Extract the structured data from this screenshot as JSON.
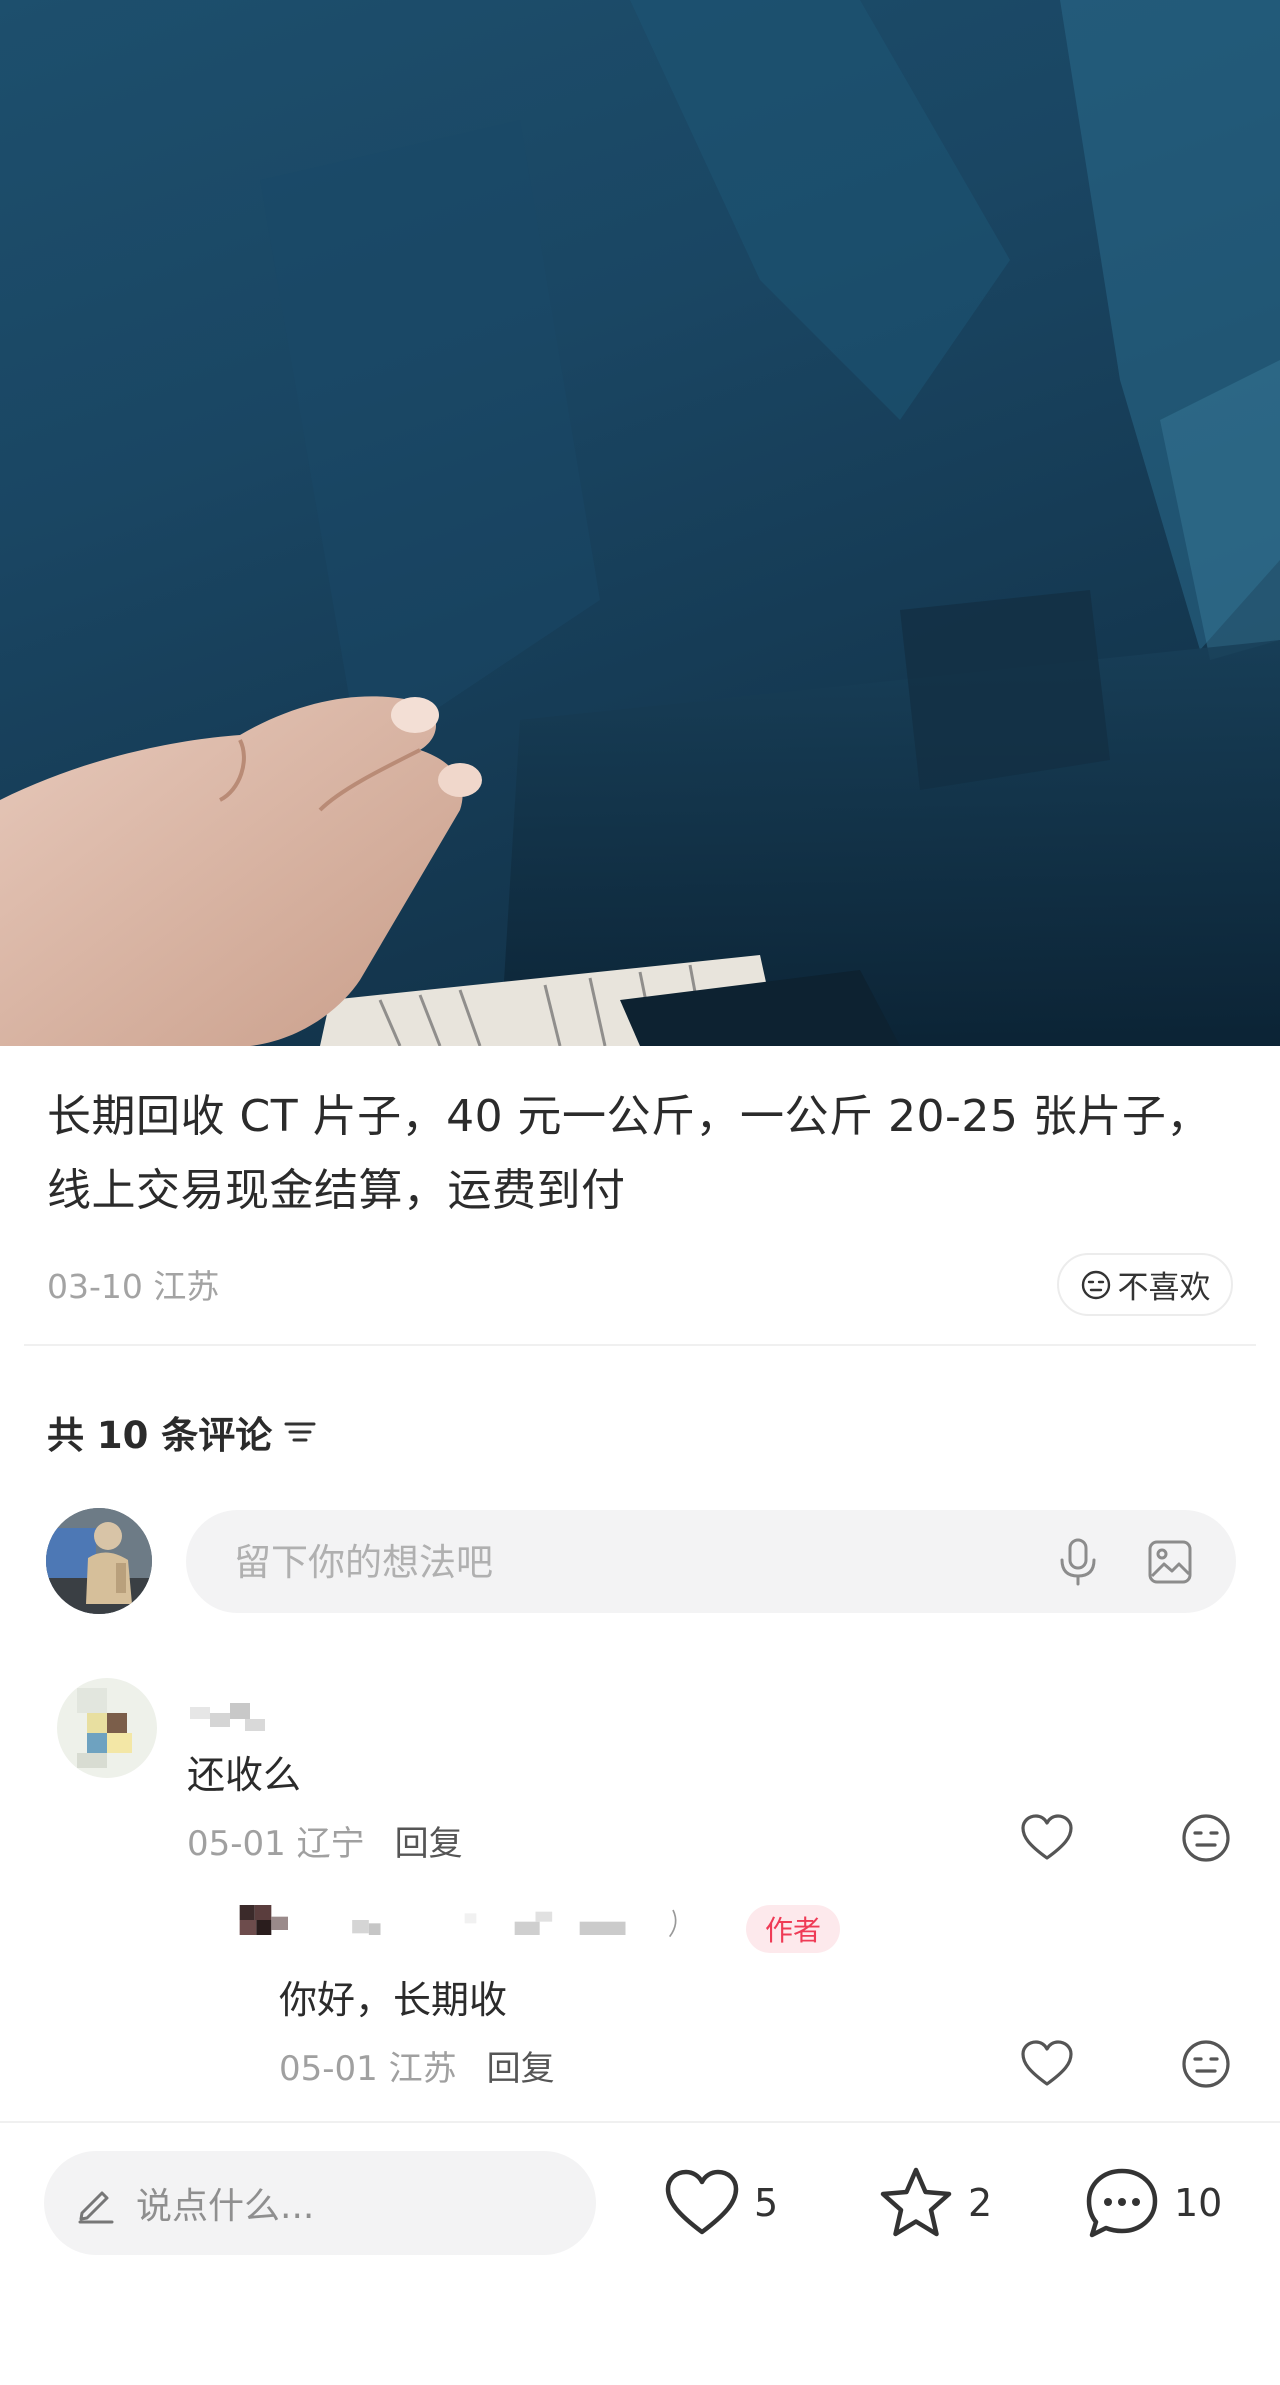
{
  "post": {
    "text": "长期回收 CT 片子，40 元一公斤，一公斤 20-25 张片子，线上交易现金结算，运费到付",
    "date": "03-10",
    "location": "江苏",
    "dislike_label": "不喜欢"
  },
  "comments_header": {
    "title": "共 10 条评论"
  },
  "comment_input": {
    "placeholder": "留下你的想法吧"
  },
  "comments": [
    {
      "text": "还收么",
      "date": "05-01",
      "location": "辽宁",
      "reply_label": "回复",
      "replies": [
        {
          "badge": "作者",
          "text": "你好，长期收",
          "date": "05-01",
          "location": "江苏",
          "reply_label": "回复"
        }
      ]
    }
  ],
  "bottom_bar": {
    "say_placeholder": "说点什么...",
    "likes": "5",
    "favorites": "2",
    "comments": "10"
  },
  "icons": {
    "dislike": "neutral-face-icon",
    "sort": "sort-lines-icon",
    "mic": "microphone-icon",
    "image": "image-icon",
    "like": "heart-icon",
    "favorite": "star-icon",
    "comment": "chat-bubble-icon",
    "edit": "pencil-icon"
  }
}
